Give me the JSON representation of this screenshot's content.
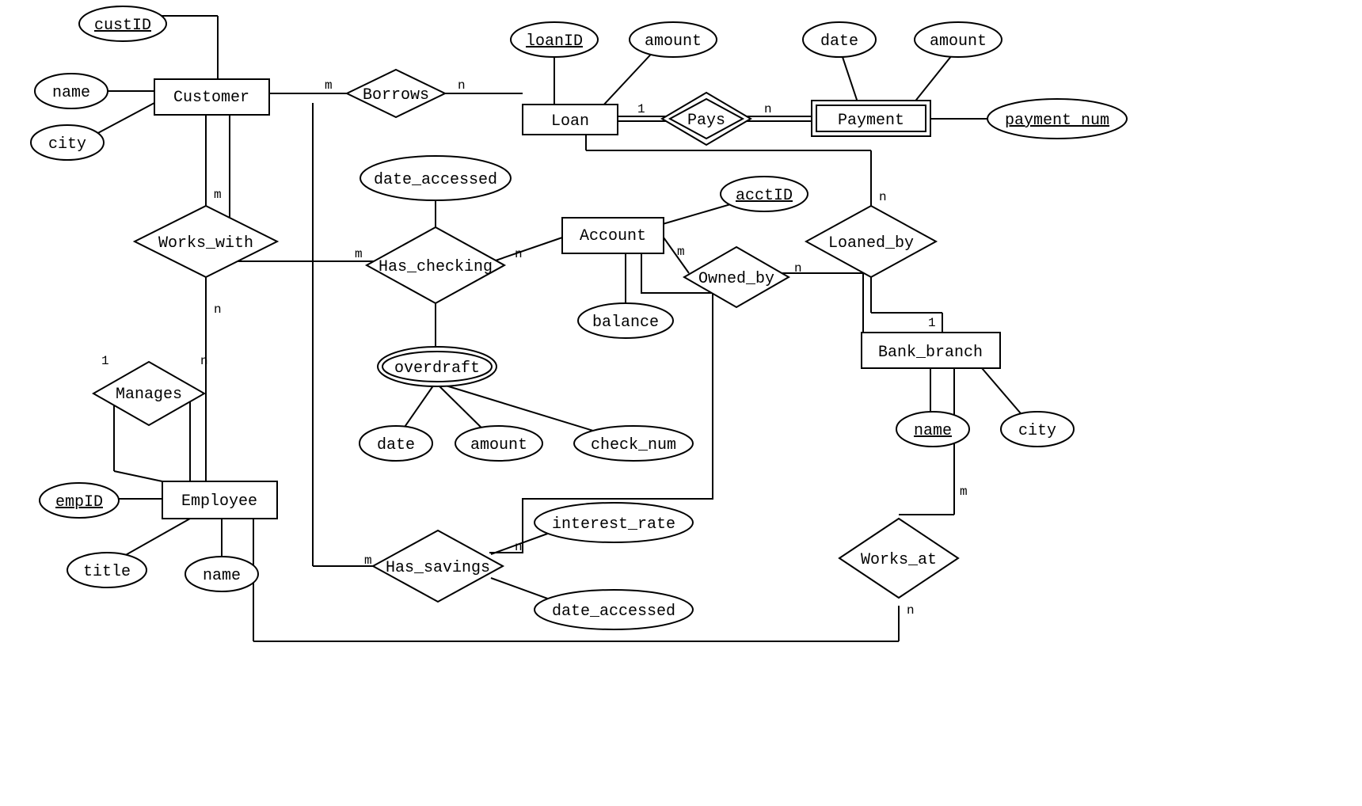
{
  "entities": {
    "customer": "Customer",
    "employee": "Employee",
    "loan": "Loan",
    "payment": "Payment",
    "account": "Account",
    "bank_branch": "Bank_branch"
  },
  "relationships": {
    "borrows": "Borrows",
    "pays": "Pays",
    "works_with": "Works_with",
    "manages": "Manages",
    "has_checking": "Has_checking",
    "has_savings": "Has_savings",
    "owned_by": "Owned_by",
    "loaned_by": "Loaned_by",
    "works_at": "Works_at"
  },
  "attributes": {
    "custID": "custID",
    "cust_name": "name",
    "cust_city": "city",
    "empID": "empID",
    "emp_title": "title",
    "emp_name": "name",
    "loanID": "loanID",
    "loan_amount": "amount",
    "pay_date": "date",
    "pay_amount": "amount",
    "payment_num": "payment_num",
    "hc_date_accessed": "date_accessed",
    "overdraft": "overdraft",
    "od_date": "date",
    "od_amount": "amount",
    "od_check_num": "check_num",
    "hs_interest_rate": "interest_rate",
    "hs_date_accessed": "date_accessed",
    "acctID": "acctID",
    "balance": "balance",
    "bb_name": "name",
    "bb_city": "city"
  },
  "card": {
    "m": "m",
    "n": "n",
    "one": "1"
  }
}
